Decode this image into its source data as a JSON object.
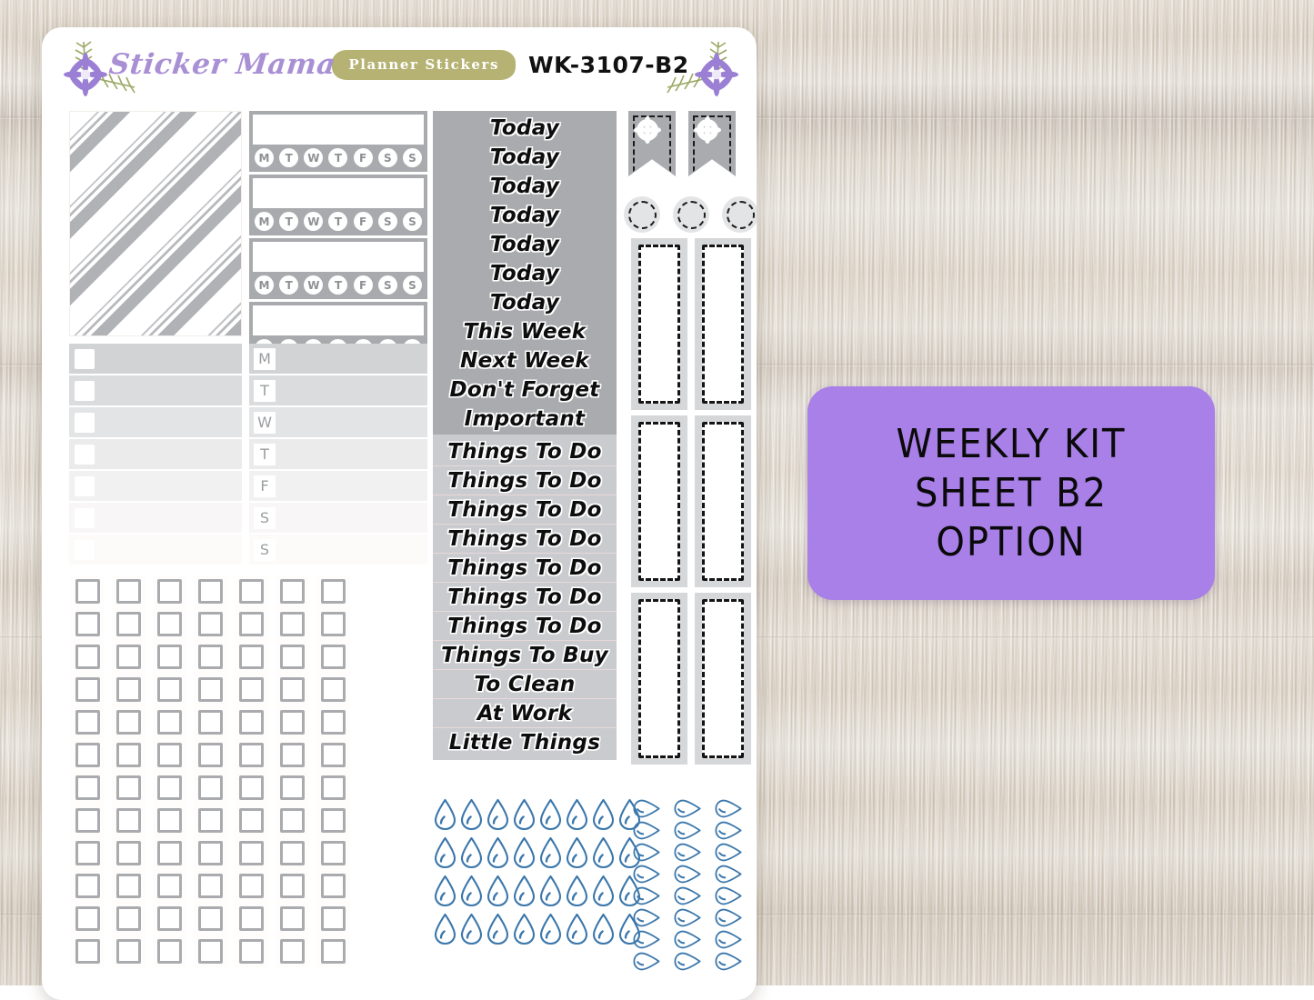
{
  "background": {
    "name": "weathered-wood-texture",
    "base_color": "#e9dfd0"
  },
  "sheet": {
    "header": {
      "brand_title": "Sticker Mama",
      "badge_text": "Planner Stickers",
      "sheet_code": "WK-3107-B2",
      "brand_color": "#a98fd4",
      "badge_color": "#b5b273",
      "flower_color": "#9b7fd4",
      "leaf_color": "#9aa863"
    },
    "stripe_box": {
      "label": "diagonal-stripe-pattern",
      "stripe_color": "#b0b2b5"
    },
    "habit_trackers": {
      "count": 4,
      "day_letters": [
        "M",
        "T",
        "W",
        "T",
        "F",
        "S",
        "S"
      ],
      "bar_color": "#a8aaad"
    },
    "check_rows": {
      "count": 7,
      "shades": [
        "#d2d3d5",
        "#dbdcde",
        "#e3e4e5",
        "#ebebec",
        "#f2f1f1",
        "#f8f6f6",
        "#fcfbfa"
      ]
    },
    "day_rows": {
      "letters": [
        "M",
        "T",
        "W",
        "T",
        "F",
        "S",
        "S"
      ],
      "shades": [
        "#d2d3d5",
        "#dbdcde",
        "#e3e4e5",
        "#ebebec",
        "#f2f1f1",
        "#f8f6f6",
        "#fcfbfa"
      ]
    },
    "checkbox_grid": {
      "columns": 7,
      "rows": 12,
      "box_border_color": "#a9abae"
    },
    "today_strip": {
      "background": "#a9abae",
      "lines": [
        "Today",
        "Today",
        "Today",
        "Today",
        "Today",
        "Today",
        "Today",
        "This Week",
        "Next Week",
        "Don't Forget",
        "Important"
      ]
    },
    "todo_strip": {
      "background": "#c9cbce",
      "lines": [
        "Things To Do",
        "Things To Do",
        "Things To Do",
        "Things To Do",
        "Things To Do",
        "Things To Do",
        "Things To Do",
        "Things To Buy",
        "To Clean",
        "At Work",
        "Little Things"
      ]
    },
    "banner_flags": {
      "count": 2,
      "color": "#a9abae",
      "icon": "flower-icon"
    },
    "dashed_circles": {
      "count": 3,
      "color": "#e3e4e6"
    },
    "tall_dashed_boxes": {
      "count": 6,
      "frame_color": "#d6d7d9",
      "dash_color": "#141414"
    },
    "water_drops": {
      "columns": 8,
      "rows": 4,
      "color": "#3b77ab"
    },
    "water_drops_side": {
      "columns": 3,
      "rows": 8,
      "color": "#3b77ab"
    }
  },
  "purple_label": {
    "background": "#a97fe8",
    "lines": [
      "WEEKLY KIT",
      "SHEET B2",
      "OPTION"
    ]
  }
}
